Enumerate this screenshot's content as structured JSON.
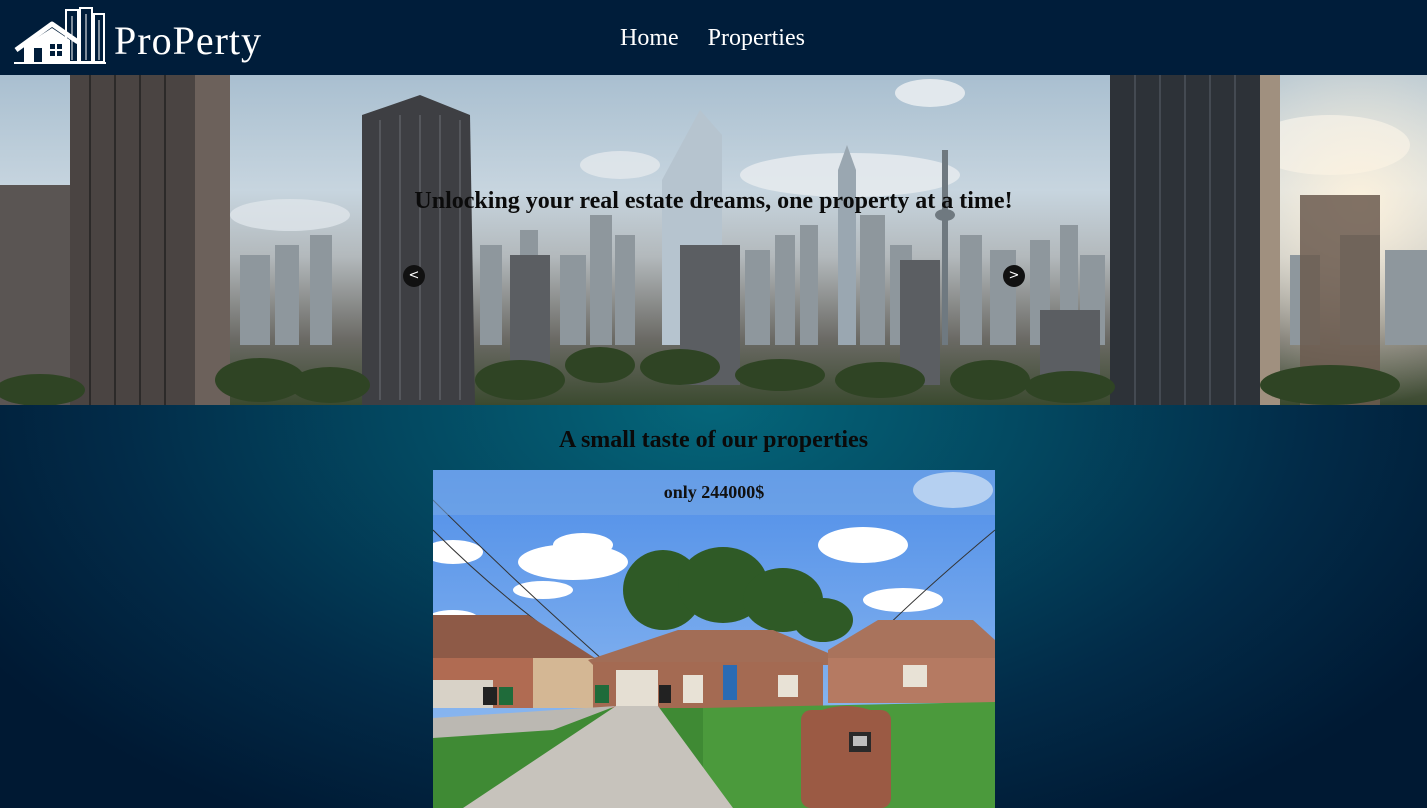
{
  "nav": {
    "brand": "ProPerty",
    "links": [
      {
        "label": "Home"
      },
      {
        "label": "Properties"
      }
    ]
  },
  "hero": {
    "tagline": "Unlocking your real estate dreams, one property at a time!"
  },
  "showcase": {
    "title": "A small taste of our properties",
    "price_label": "only 244000$",
    "prev_label": "<",
    "next_label": ">"
  },
  "colors": {
    "navbar": "#001d3a",
    "main_center": "#05667a",
    "main_edge": "#001933",
    "price_banner": "#78aae6"
  },
  "icons": [
    "house-buildings-logo-icon"
  ]
}
